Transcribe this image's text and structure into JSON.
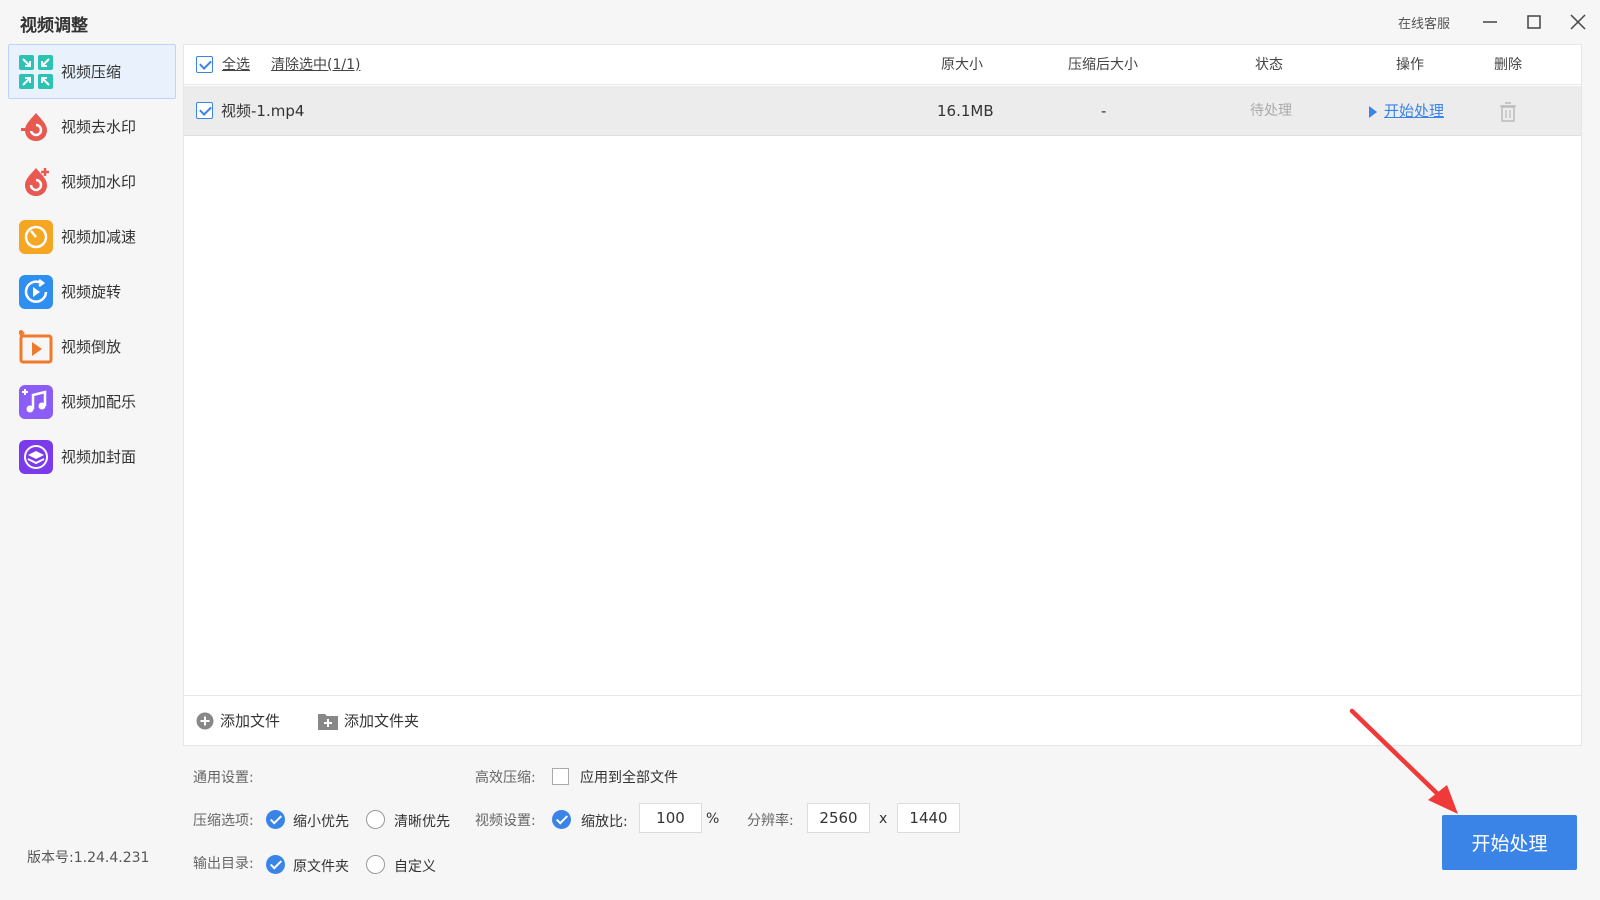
{
  "app": {
    "title": "视频调整",
    "support": "在线客服",
    "version": "版本号:1.24.4.231"
  },
  "sidebar": {
    "items": [
      {
        "label": "视频压缩",
        "icon": "compress-icon",
        "color": "#2dc3b4"
      },
      {
        "label": "视频去水印",
        "icon": "remove-watermark-icon",
        "color": "#e85a50"
      },
      {
        "label": "视频加水印",
        "icon": "add-watermark-icon",
        "color": "#e85a50"
      },
      {
        "label": "视频加减速",
        "icon": "speed-icon",
        "color": "#f5a623"
      },
      {
        "label": "视频旋转",
        "icon": "rotate-icon",
        "color": "#2f8ff0"
      },
      {
        "label": "视频倒放",
        "icon": "reverse-icon",
        "color": "#f07a2c"
      },
      {
        "label": "视频加配乐",
        "icon": "music-icon",
        "color": "#8b5cf6"
      },
      {
        "label": "视频加封面",
        "icon": "cover-icon",
        "color": "#7c3aed"
      }
    ]
  },
  "table": {
    "select_all": "全选",
    "clear_selection": "清除选中(1/1)",
    "columns": {
      "original_size": "原大小",
      "compressed_size": "压缩后大小",
      "status": "状态",
      "action": "操作",
      "delete": "删除"
    },
    "rows": [
      {
        "name": "视频-1.mp4",
        "original_size": "16.1MB",
        "compressed_size": "-",
        "status": "待处理",
        "action": "开始处理",
        "checked": true
      }
    ]
  },
  "footer": {
    "add_file": "添加文件",
    "add_folder": "添加文件夹"
  },
  "settings": {
    "general_label": "通用设置:",
    "efficient_label": "高效压缩:",
    "apply_all": "应用到全部文件",
    "compress_label": "压缩选项:",
    "opt_small": "缩小优先",
    "opt_clear": "清晰优先",
    "video_label": "视频设置:",
    "scale_label": "缩放比:",
    "scale_value": "100",
    "percent": "%",
    "resolution_label": "分辨率:",
    "width": "2560",
    "x_sep": "x",
    "height": "1440",
    "output_label": "输出目录:",
    "out_original": "原文件夹",
    "out_custom": "自定义"
  },
  "start_button": "开始处理",
  "colors": {
    "accent": "#3a84e8",
    "annotation_arrow": "#f03a3a"
  }
}
